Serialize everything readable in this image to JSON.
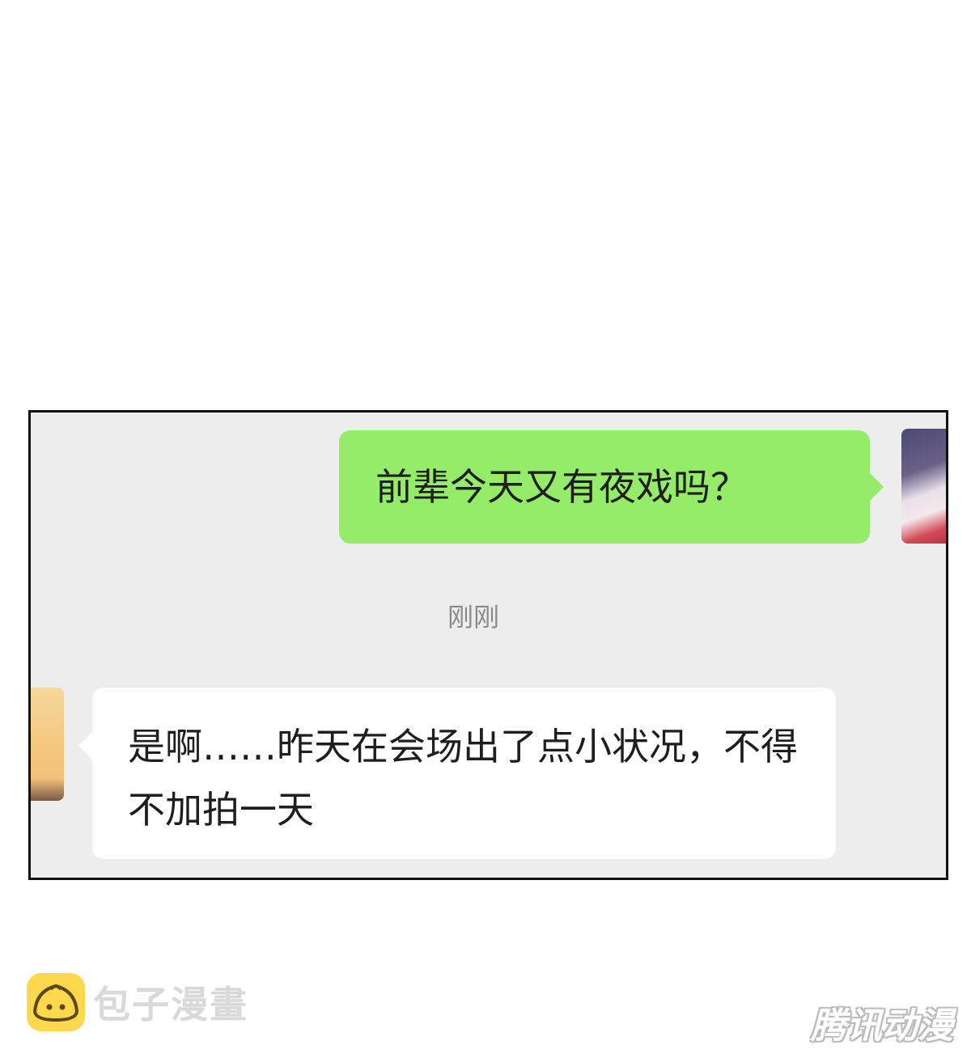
{
  "chat": {
    "messages": [
      {
        "sender": "self",
        "text": "前辈今天又有夜戏吗？"
      },
      {
        "sender": "other",
        "text": "是啊……昨天在会场出了点小状况，不得不加拍一天"
      }
    ],
    "timestamp": "刚刚"
  },
  "watermarks": {
    "left": "包子漫畫",
    "right": "腾讯动漫"
  },
  "colors": {
    "sent_bubble": "#95ec69",
    "received_bubble": "#ffffff",
    "chat_background": "#ededed",
    "timestamp": "#8a8a8a"
  }
}
